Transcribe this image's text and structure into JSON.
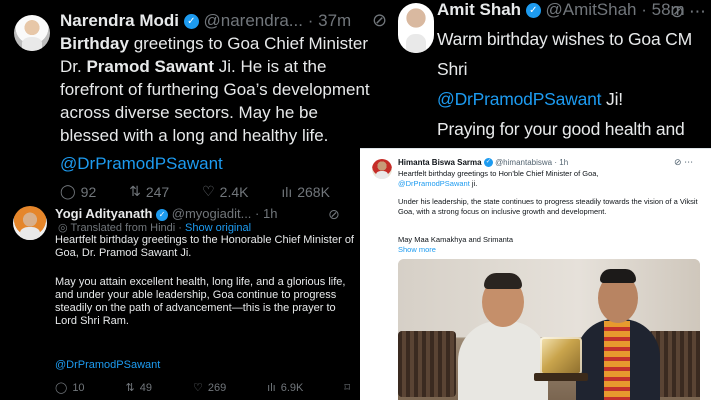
{
  "modi": {
    "name": "Narendra Modi",
    "handle": "@narendra...",
    "time": "37m",
    "more_icon": "grok-slash-icon",
    "text_parts": [
      "Birthday",
      " greetings to Goa Chief Minister Dr. ",
      "Pramod Sawant",
      " Ji. He is at the forefront of furthering Goa’s development across diverse sectors. May he be blessed with a long and healthy life."
    ],
    "mention": "@DrPramodPSawant",
    "metrics": {
      "replies": "92",
      "reposts": "247",
      "likes": "2.4K",
      "views": "268K"
    }
  },
  "amit": {
    "name": "Amit Shah",
    "handle": "@AmitShah",
    "time": "58m",
    "icons": [
      "grok-slash-icon",
      "more-icon"
    ],
    "line1": "Warm birthday wishes to Goa CM Shri",
    "mention": "@DrPramodPSawant",
    "mention_suffix": " Ji!",
    "line3": "Praying for your good health and continued public service."
  },
  "yogi": {
    "name": "Yogi Adityanath",
    "handle": "@myogiadit...",
    "time": "1h",
    "translated_label": "Translated from Hindi",
    "show_original": "Show original",
    "paragraph1": "Heartfelt birthday greetings to the Honorable Chief Minister of Goa, Dr. Pramod Sawant Ji.",
    "paragraph2": "May you attain excellent health, long life, and a glorious life, and under your able leadership, Goa continue to progress steadily on the path of advancement—this is the prayer to Lord Shri Ram.",
    "mention": "@DrPramodPSawant",
    "metrics": {
      "replies": "10",
      "reposts": "49",
      "likes": "269",
      "views": "6.9K"
    }
  },
  "himanta": {
    "name": "Himanta Biswa Sarma",
    "handle": "@himantabiswa",
    "time": "1h",
    "line1": "Heartfelt birthday greetings to Hon’ble Chief Minister of Goa,",
    "mention": "@DrPramodPSawant",
    "mention_suffix": " ji.",
    "paragraph2": "Under his leadership, the state continues to progress steadily towards the vision of a Viksit Goa, with a strong focus on inclusive growth and development.",
    "paragraph3": "May Maa Kamakhya and Srimanta",
    "show_more": "Show more"
  },
  "colors": {
    "dark_bg": "#000000",
    "light_bg": "#ffffff",
    "link": "#1d9bf0",
    "muted": "#71767b",
    "text_dark": "#e7e9ea"
  }
}
